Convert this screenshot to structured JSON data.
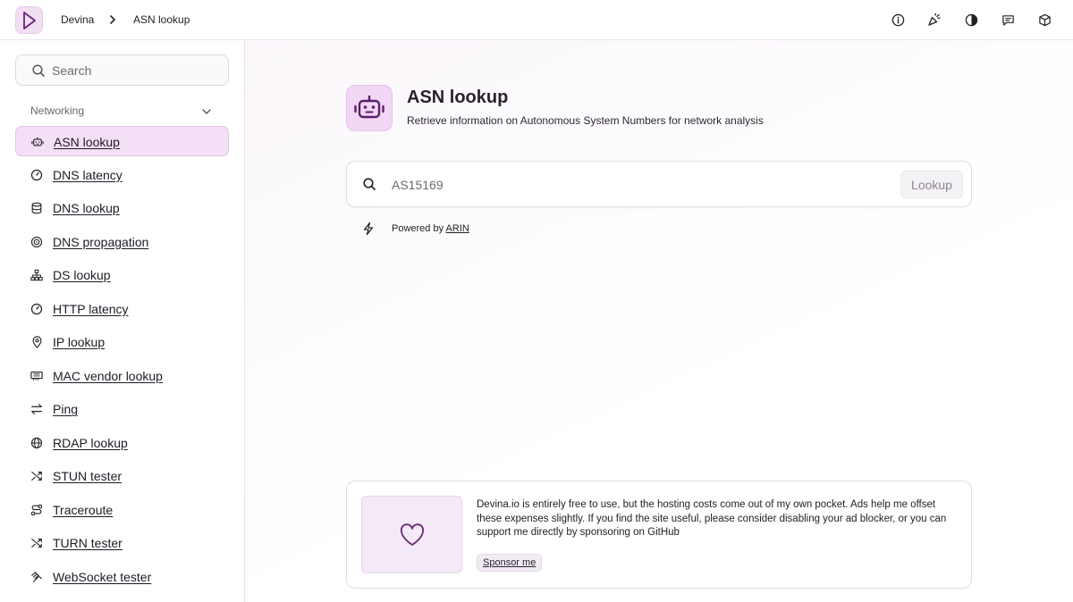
{
  "header": {
    "breadcrumb": [
      "Devina",
      "ASN lookup"
    ],
    "icons": [
      "info-icon",
      "whats-new-icon",
      "theme-icon",
      "feedback-icon",
      "package-icon"
    ]
  },
  "sidebar": {
    "search_placeholder": "Search",
    "section": "Networking",
    "items": [
      {
        "label": "ASN lookup",
        "icon": "robot-icon",
        "active": true
      },
      {
        "label": "DNS latency",
        "icon": "gauge-icon"
      },
      {
        "label": "DNS lookup",
        "icon": "database-icon"
      },
      {
        "label": "DNS propagation",
        "icon": "radar-icon"
      },
      {
        "label": "DS lookup",
        "icon": "hierarchy-icon"
      },
      {
        "label": "HTTP latency",
        "icon": "gauge-icon"
      },
      {
        "label": "IP lookup",
        "icon": "map-pin-icon"
      },
      {
        "label": "MAC vendor lookup",
        "icon": "network-card-icon"
      },
      {
        "label": "Ping",
        "icon": "arrows-exchange-icon"
      },
      {
        "label": "RDAP lookup",
        "icon": "globe-icon"
      },
      {
        "label": "STUN tester",
        "icon": "shuffle-icon"
      },
      {
        "label": "Traceroute",
        "icon": "route-icon"
      },
      {
        "label": "TURN tester",
        "icon": "shuffle-icon"
      },
      {
        "label": "WebSocket tester",
        "icon": "websocket-icon"
      }
    ]
  },
  "main": {
    "title": "ASN lookup",
    "description": "Retrieve information on Autonomous System Numbers for network analysis",
    "input_placeholder": "AS15169",
    "button_label": "Lookup",
    "powered_prefix": "Powered by",
    "powered_link": "ARIN",
    "sponsor": {
      "text": "Devina.io is entirely free to use, but the hosting costs come out of my own pocket. Ads help me offset these expenses slightly. If you find the site useful, please consider disabling your ad blocker, or you can support me directly by sponsoring on GitHub",
      "button": "Sponsor me"
    }
  },
  "colors": {
    "accent": "#6b2479",
    "accent_bg": "#f3dff6"
  }
}
